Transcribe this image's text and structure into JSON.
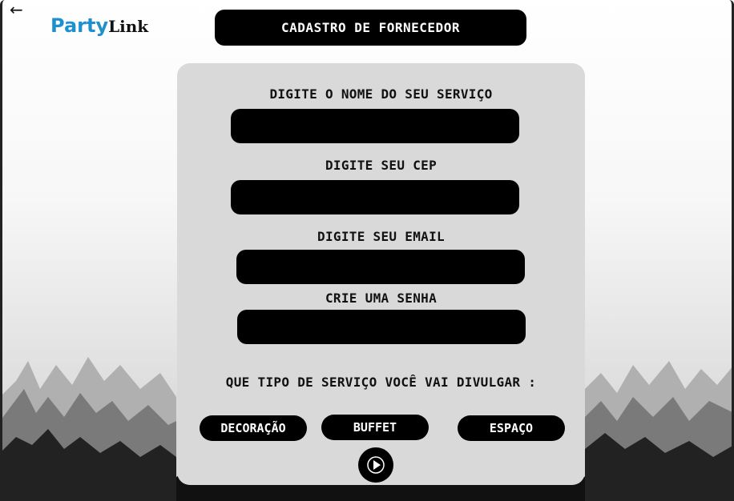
{
  "header": {
    "back_icon": "←",
    "logo_part1": "Party",
    "logo_part2": "Link",
    "title": "CADASTRO DE FORNECEDOR"
  },
  "form": {
    "service_name_label": "DIGITE O NOME DO SEU SERVIÇO",
    "service_name_value": "",
    "cep_label": "DIGITE SEU CEP",
    "cep_value": "",
    "email_label": "DIGITE SEU EMAIL",
    "email_value": "",
    "password_label": "CRIE UMA SENHA",
    "password_value": "",
    "service_type_question": "QUE TIPO DE SERVIÇO VOCÊ VAI DIVULGAR :",
    "service_types": [
      "DECORAÇÃO",
      "BUFFET",
      "ESPAÇO"
    ],
    "submit_icon": "play-icon"
  },
  "colors": {
    "logo_blue": "#1e90d0",
    "card_bg": "#d9d9d9",
    "pill_bg": "#000000"
  }
}
